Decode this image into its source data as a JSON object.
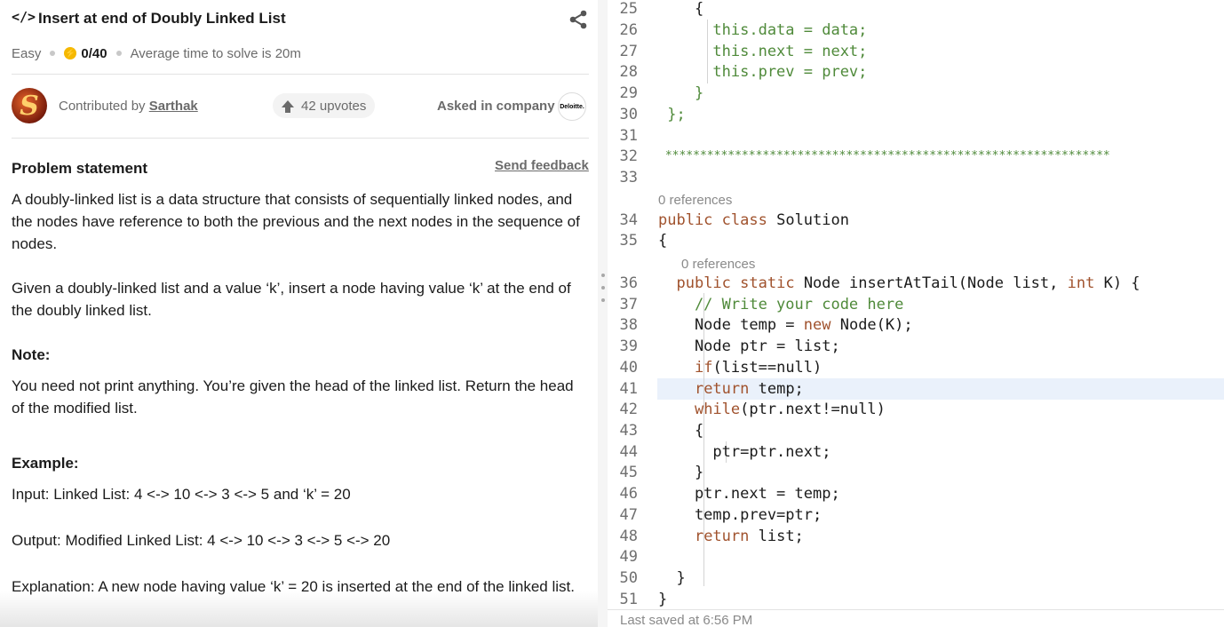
{
  "problem": {
    "title": "Insert at end of Doubly Linked List",
    "difficulty": "Easy",
    "score": "0/40",
    "avg_time": "Average time to solve is 20m",
    "contributed_prefix": "Contributed by ",
    "contributor": "Sarthak",
    "avatar_letter": "S",
    "upvotes": "42 upvotes",
    "asked_label": "Asked in company",
    "company_logo_text": "Deloitte.",
    "statement_title": "Problem statement",
    "feedback_label": "Send feedback",
    "paragraphs": [
      "A doubly-linked list is a data structure that consists of sequentially linked nodes, and the nodes have reference to both the previous and the next nodes in the sequence of nodes.",
      "Given a doubly-linked list and a value ‘k’, insert a node having value ‘k’ at the end of the doubly linked list.",
      "Note:",
      "You need not print anything. You’re given the head of the linked list. Return the head of the modified list.",
      "Example:",
      "Input: Linked List: 4 <-> 10 <-> 3 <-> 5 and ‘k’ = 20",
      "Output: Modified Linked List: 4 <-> 10 <-> 3 <-> 5 <-> 20",
      "Explanation: A new node having value ‘k’ = 20 is inserted at the end of the linked list."
    ]
  },
  "editor": {
    "references_label": "0 references",
    "lines": [
      {
        "n": "25",
        "text": "    {"
      },
      {
        "n": "26",
        "text": "      this.data = data;"
      },
      {
        "n": "27",
        "text": "      this.next = next;"
      },
      {
        "n": "28",
        "text": "      this.prev = prev;"
      },
      {
        "n": "29",
        "text": "    }"
      },
      {
        "n": "30",
        "text": " };"
      },
      {
        "n": "31",
        "text": ""
      },
      {
        "n": "32",
        "text": " ****************************************************************"
      },
      {
        "n": "33",
        "text": ""
      },
      {
        "n": "34",
        "text": "public class Solution"
      },
      {
        "n": "35",
        "text": "{"
      },
      {
        "n": "36",
        "text": "  public static Node insertAtTail(Node list, int K) {"
      },
      {
        "n": "37",
        "text": "    // Write your code here"
      },
      {
        "n": "38",
        "text": "    Node temp = new Node(K);"
      },
      {
        "n": "39",
        "text": "    Node ptr = list;"
      },
      {
        "n": "40",
        "text": "    if(list==null)"
      },
      {
        "n": "41",
        "text": "    return temp;"
      },
      {
        "n": "42",
        "text": "    while(ptr.next!=null)"
      },
      {
        "n": "43",
        "text": "    {"
      },
      {
        "n": "44",
        "text": "      ptr=ptr.next;"
      },
      {
        "n": "45",
        "text": "    }"
      },
      {
        "n": "46",
        "text": "    ptr.next = temp;"
      },
      {
        "n": "47",
        "text": "    temp.prev=ptr;"
      },
      {
        "n": "48",
        "text": "    return list;"
      },
      {
        "n": "49",
        "text": ""
      },
      {
        "n": "50",
        "text": "  }"
      },
      {
        "n": "51",
        "text": "}"
      }
    ],
    "status": "Last saved at 6:56 PM"
  },
  "colors": {
    "keyword": "#a0522d",
    "comment": "#4f8a3a",
    "highlight": "#eaf1fb",
    "coin": "#f5b800"
  }
}
